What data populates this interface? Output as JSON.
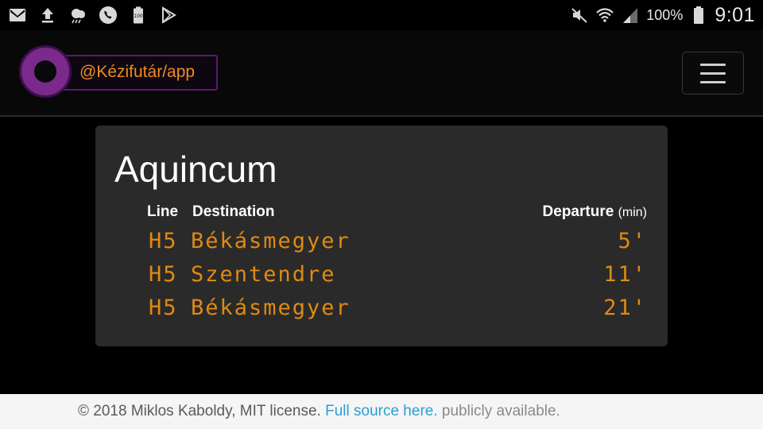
{
  "status_bar": {
    "left_icons": [
      "gmail-icon",
      "upload-icon",
      "weather-icon",
      "phone-icon",
      "battery-100-icon",
      "play-store-icon"
    ],
    "right_icons": [
      "mute-icon",
      "wifi-icon",
      "signal-icon"
    ],
    "battery_percent": "100%",
    "time": "9:01"
  },
  "navbar": {
    "brand_text": "@Kézifutár/app",
    "brand_color": "#f08a24",
    "accent_purple": "#7a2a8a",
    "menu_icon": "hamburger-icon"
  },
  "station": {
    "name": "Aquincum",
    "headers": {
      "line": "Line",
      "destination": "Destination",
      "departure": "Departure",
      "departure_unit": "(min)"
    },
    "departures": [
      {
        "line": "H5",
        "destination": "Békásmegyer",
        "minutes": "5'"
      },
      {
        "line": "H5",
        "destination": "Szentendre",
        "minutes": "11'"
      },
      {
        "line": "H5",
        "destination": "Békásmegyer",
        "minutes": "21'"
      }
    ],
    "departure_color": "#e08a12"
  },
  "footer": {
    "copyright": "© 2018 Miklos Kaboldy, MIT license.",
    "link_text": "Full source here.",
    "suffix": "publicly available.",
    "link_color": "#2a9fd6"
  }
}
